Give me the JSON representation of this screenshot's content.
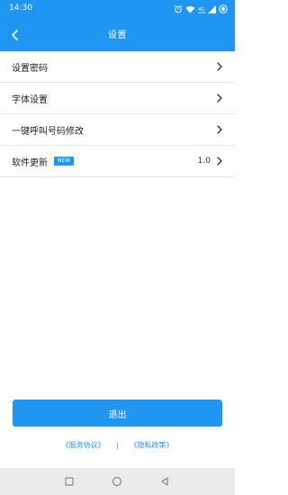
{
  "status_bar": {
    "time": "14:30",
    "icons": [
      "alarm-icon",
      "wifi-icon",
      "signal-4g-icon",
      "signal-icon",
      "battery-icon"
    ]
  },
  "navbar": {
    "back_icon": "chevron-left-icon",
    "title": "设置"
  },
  "settings": {
    "items": [
      {
        "label": "设置密码"
      },
      {
        "label": "字体设置"
      },
      {
        "label": "一键呼叫号码修改"
      },
      {
        "label": "软件更新",
        "badge": "NEW",
        "value": "1.0"
      }
    ]
  },
  "logout_label": "退出",
  "links": {
    "service_agreement": "《服务协议》",
    "separator": "|",
    "privacy_policy": "《隐私政策》"
  },
  "system_nav": [
    "square-icon",
    "circle-icon",
    "triangle-back-icon"
  ],
  "colors": {
    "accent": "#1f96f2",
    "nav_background": "#ebebeb"
  }
}
